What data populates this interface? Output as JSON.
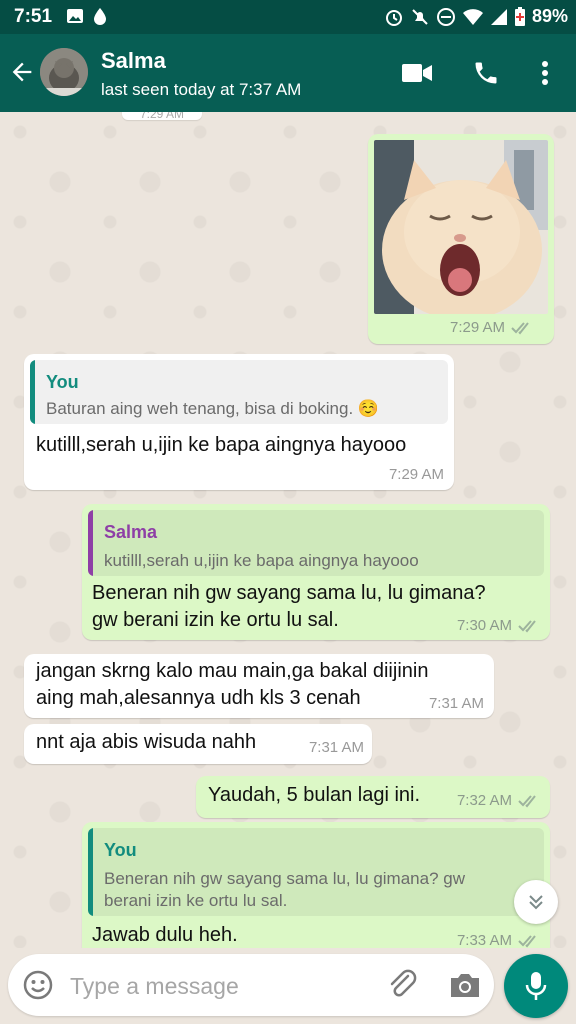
{
  "status_bar": {
    "time": "7:51",
    "battery": "89%"
  },
  "header": {
    "name": "Salma",
    "last_seen": "last seen today at 7:37 AM"
  },
  "icons": {
    "back": "arrow-left-icon",
    "video": "video-call-icon",
    "call": "phone-icon",
    "menu": "more-vert-icon",
    "emoji": "emoji-icon",
    "attach": "paperclip-icon",
    "camera": "camera-icon",
    "mic": "microphone-icon",
    "scroll": "chevron-double-down-icon"
  },
  "colors": {
    "header": "#075e54",
    "statusbar": "#054d44",
    "outgoing": "#dcf8c6",
    "incoming": "#ffffff",
    "accent": "#00897b",
    "quote_you": "#128c7e",
    "quote_salma": "#8e3fa6"
  },
  "messages": {
    "m0": {
      "time": "7:29 AM"
    },
    "m1": {
      "time": "7:29 AM"
    },
    "m2": {
      "quote_author": "You",
      "quote_text": "Baturan aing weh tenang, bisa di boking. ☺️",
      "text": "kutilll,serah u,ijin ke bapa aingnya hayooo",
      "time": "7:29 AM"
    },
    "m3": {
      "quote_author": "Salma",
      "quote_text": "kutilll,serah u,ijin ke bapa aingnya hayooo",
      "line1": "Beneran nih gw sayang sama lu, lu gimana?",
      "line2": "gw berani izin ke ortu lu sal.",
      "time": "7:30 AM"
    },
    "m4": {
      "line1": "jangan skrng kalo mau main,ga bakal diijinin",
      "line2": "aing mah,alesannya udh kls 3 cenah",
      "time": "7:31 AM"
    },
    "m5": {
      "text": "nnt aja abis wisuda nahh",
      "time": "7:31 AM"
    },
    "m6": {
      "text": "Yaudah, 5 bulan lagi ini.",
      "time": "7:32 AM"
    },
    "m7": {
      "quote_author": "You",
      "quote_line1": "Beneran nih gw sayang sama lu, lu gimana? gw",
      "quote_line2": "berani izin ke ortu lu sal.",
      "text": "Jawab dulu heh.",
      "time": "7:33 AM"
    }
  },
  "composer": {
    "placeholder": "Type a message",
    "value": ""
  }
}
